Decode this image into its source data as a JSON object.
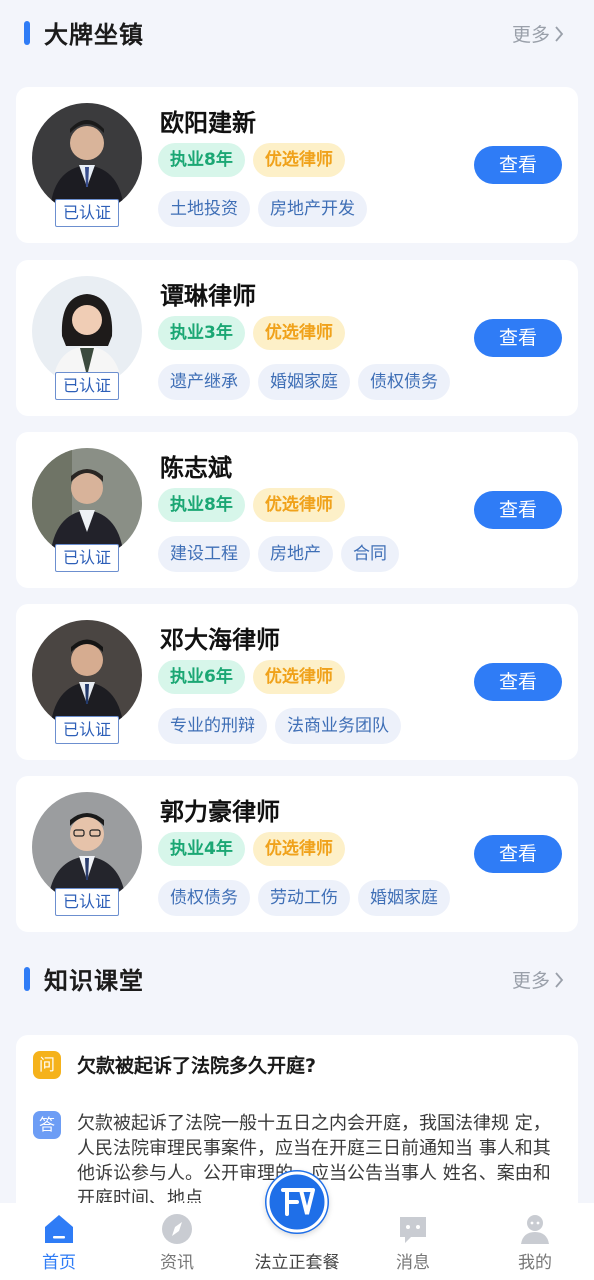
{
  "featured": {
    "title": "大牌坐镇",
    "more": "更多",
    "view_label": "查看",
    "verified_label": "已认证",
    "lawyers": [
      {
        "name": "欧阳建新",
        "experience": "执业8年",
        "badge": "优选律师",
        "tags": [
          "土地投资",
          "房地产开发"
        ]
      },
      {
        "name": "谭琳律师",
        "experience": "执业3年",
        "badge": "优选律师",
        "tags": [
          "遗产继承",
          "婚姻家庭",
          "债权债务"
        ]
      },
      {
        "name": "陈志斌",
        "experience": "执业8年",
        "badge": "优选律师",
        "tags": [
          "建设工程",
          "房地产",
          "合同"
        ]
      },
      {
        "name": "邓大海律师",
        "experience": "执业6年",
        "badge": "优选律师",
        "tags": [
          "专业的刑辩",
          "法商业务团队"
        ]
      },
      {
        "name": "郭力豪律师",
        "experience": "执业4年",
        "badge": "优选律师",
        "tags": [
          "债权债务",
          "劳动工伤",
          "婚姻家庭"
        ]
      }
    ]
  },
  "knowledge": {
    "title": "知识课堂",
    "more": "更多",
    "q_icon": "问",
    "a_icon": "答",
    "question": "欠款被起诉了法院多久开庭?",
    "answer": "欠款被起诉了法院一般十五日之内会开庭，我国法律规 定，人民法院审理民事案件，应当在开庭三日前通知当 事人和其他诉讼参与人。公开审理的，应当公告当事人 姓名、案由和开庭时间、地点"
  },
  "tabbar": {
    "items": [
      {
        "label": "首页",
        "icon": "home-icon"
      },
      {
        "label": "资讯",
        "icon": "compass-icon"
      },
      {
        "label": "法立正套餐",
        "icon": "brand-logo-icon"
      },
      {
        "label": "消息",
        "icon": "chat-icon"
      },
      {
        "label": "我的",
        "icon": "profile-icon"
      }
    ]
  },
  "colors": {
    "accent": "#2f7cf6",
    "green_tag": "#1ba774",
    "orange_tag": "#f0a21b"
  }
}
